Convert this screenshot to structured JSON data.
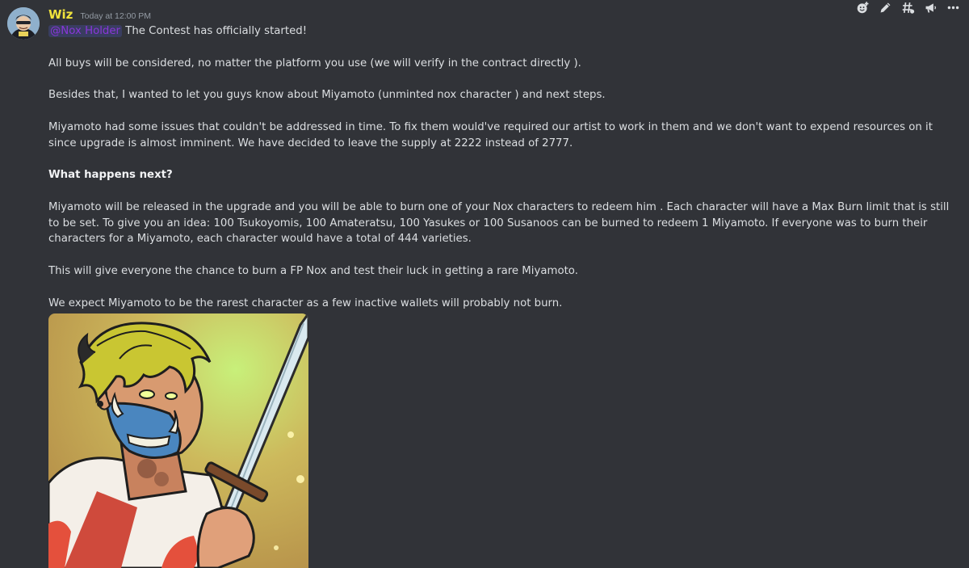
{
  "message": {
    "author": "Wiz",
    "timestamp": "Today at 12:00 PM",
    "mention": "@Nox Holder",
    "first_line": " The Contest has officially started!",
    "p_buys": "All buys will be considered, no matter the platform you use (we will verify in the contract directly ).",
    "p_besides": "Besides that, I wanted to let you guys know about Miyamoto (unminted nox character ) and next steps.",
    "p_issues": "Miyamoto had some issues that couldn't be addressed in time. To fix them would've required our artist to work in them and we don't want to expend resources on it since upgrade is almost imminent. We have decided to leave the supply at 2222 instead of 2777.",
    "heading": "What happens next?",
    "p_release": "Miyamoto will be released in the upgrade and you will be able to burn one of your Nox characters to redeem him . Each character will have a Max Burn limit that is still to be set. To give you an idea: 100 Tsukoyomis, 100 Amateratsu, 100 Yasukes or 100 Susanoos can be burned to redeem 1 Miyamoto. If everyone was to burn their characters for a Miyamoto, each character would have a total of 444 varieties.",
    "p_chance": "This will give everyone the chance to burn a FP Nox and test their luck in getting a rare Miyamoto.",
    "p_rarest": "We expect Miyamoto to be the rarest character as a few inactive wallets will probably not burn."
  },
  "toolbar": {
    "icons": [
      "add-reaction-icon",
      "edit-icon",
      "thread-icon",
      "megaphone-icon",
      "more-icon"
    ]
  },
  "colors": {
    "background": "#313338",
    "username": "#f0e33c",
    "mention": "#8a36d9",
    "text": "#dbdee1",
    "timestamp": "#949ba4"
  }
}
